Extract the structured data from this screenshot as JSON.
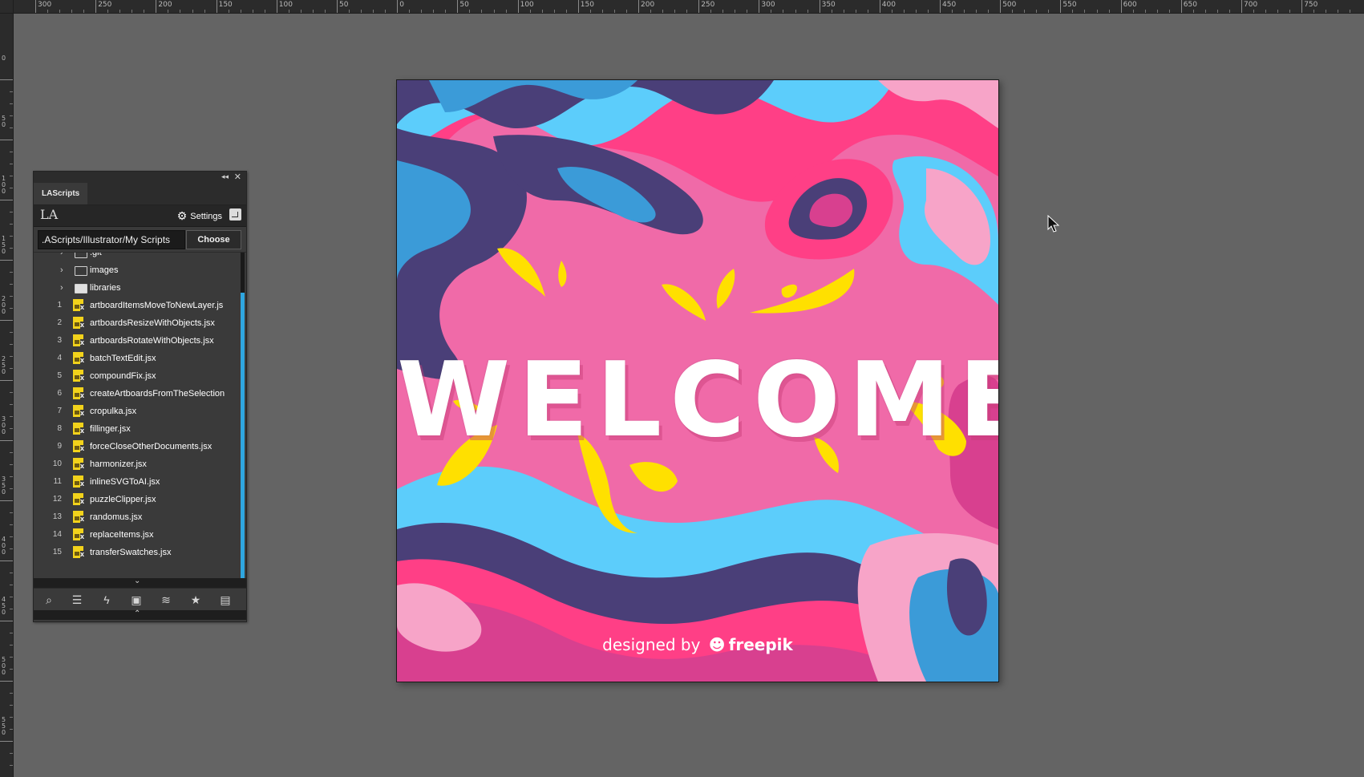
{
  "ruler": {
    "top_labels": [
      "300",
      "250",
      "200",
      "150",
      "100",
      "50",
      "0",
      "50",
      "100",
      "150",
      "200",
      "250",
      "300",
      "350",
      "400",
      "450",
      "500",
      "550",
      "600",
      "650",
      "700",
      "750"
    ],
    "left_labels": [
      "0",
      "50",
      "100",
      "150",
      "200",
      "250",
      "300",
      "350",
      "400",
      "450",
      "500",
      "550"
    ]
  },
  "panel": {
    "tab": "LAScripts",
    "logo": "LA",
    "settings_label": "Settings",
    "path_value": ".AScripts/Illustrator/My Scripts",
    "choose_label": "Choose",
    "folders": [
      {
        "label": ".git",
        "filled": false
      },
      {
        "label": "images",
        "filled": false
      },
      {
        "label": "libraries",
        "filled": true
      }
    ],
    "scripts": [
      {
        "num": "1",
        "label": "artboardItemsMoveToNewLayer.js"
      },
      {
        "num": "2",
        "label": "artboardsResizeWithObjects.jsx"
      },
      {
        "num": "3",
        "label": "artboardsRotateWithObjects.jsx"
      },
      {
        "num": "4",
        "label": "batchTextEdit.jsx"
      },
      {
        "num": "5",
        "label": "compoundFix.jsx"
      },
      {
        "num": "6",
        "label": "createArtboardsFromTheSelection"
      },
      {
        "num": "7",
        "label": "cropulka.jsx"
      },
      {
        "num": "8",
        "label": "fillinger.jsx"
      },
      {
        "num": "9",
        "label": "forceCloseOtherDocuments.jsx"
      },
      {
        "num": "10",
        "label": "harmonizer.jsx"
      },
      {
        "num": "11",
        "label": "inlineSVGToAI.jsx"
      },
      {
        "num": "12",
        "label": "puzzleClipper.jsx"
      },
      {
        "num": "13",
        "label": "randomus.jsx"
      },
      {
        "num": "14",
        "label": "replaceItems.jsx"
      },
      {
        "num": "15",
        "label": "transferSwatches.jsx"
      }
    ],
    "footer_icons": [
      "search-icon",
      "list-icon",
      "lightning-icon",
      "script-icon",
      "layers-icon",
      "star-icon",
      "linkedin-icon"
    ]
  },
  "artboard": {
    "headline": "WELCOME",
    "credit_prefix": "designed by",
    "credit_brand": "freepik"
  },
  "colors": {
    "pink_bg": "#f06aa8",
    "magenta": "#d8408f",
    "hot_pink": "#ff3f86",
    "purple": "#4a3f78",
    "blue": "#3b9bd8",
    "light_blue": "#5ccdfb",
    "light_pink": "#f7a4c8",
    "yellow": "#ffe000",
    "accent_scroll": "#2fa6df"
  }
}
